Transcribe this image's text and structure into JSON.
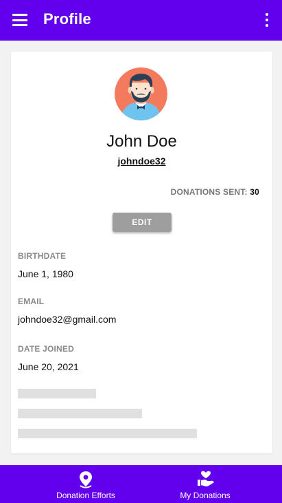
{
  "appbar": {
    "title": "Profile",
    "menu_icon": "hamburger-menu-icon",
    "more_icon": "more-vertical-icon",
    "color": "#6200ee"
  },
  "profile": {
    "avatar_icon": "user-avatar",
    "name": "John Doe",
    "username": "johndoe32",
    "donations_label": "DONATIONS SENT",
    "donations_separator": ":",
    "donations_count": "30",
    "edit_label": "EDIT"
  },
  "fields": [
    {
      "label": "BIRTHDATE",
      "value": "June 1, 1980"
    },
    {
      "label": "EMAIL",
      "value": "johndoe32@gmail.com"
    },
    {
      "label": "DATE JOINED",
      "value": "June 20, 2021"
    }
  ],
  "bottom_nav": {
    "items": [
      {
        "label": "Donation Efforts",
        "icon": "location-pin-icon"
      },
      {
        "label": "My Donations",
        "icon": "donation-hand-heart-icon"
      }
    ]
  }
}
